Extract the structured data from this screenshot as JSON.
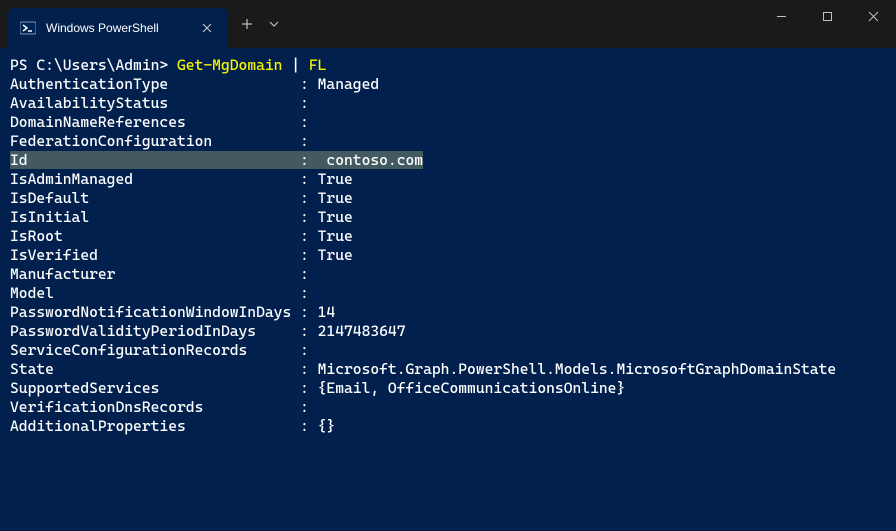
{
  "window": {
    "tab_title": "Windows PowerShell"
  },
  "prompt": {
    "path": "PS C:\\Users\\Admin> ",
    "cmd1": "Get-MgDomain",
    "pipe": " | ",
    "cmd2": "FL"
  },
  "output": {
    "props": [
      {
        "key": "AuthenticationType",
        "value": "Managed"
      },
      {
        "key": "AvailabilityStatus",
        "value": ""
      },
      {
        "key": "DomainNameReferences",
        "value": ""
      },
      {
        "key": "FederationConfiguration",
        "value": ""
      },
      {
        "key": "Id",
        "value": " contoso.com",
        "highlight": true
      },
      {
        "key": "IsAdminManaged",
        "value": "True"
      },
      {
        "key": "IsDefault",
        "value": "True"
      },
      {
        "key": "IsInitial",
        "value": "True"
      },
      {
        "key": "IsRoot",
        "value": "True"
      },
      {
        "key": "IsVerified",
        "value": "True"
      },
      {
        "key": "Manufacturer",
        "value": ""
      },
      {
        "key": "Model",
        "value": ""
      },
      {
        "key": "PasswordNotificationWindowInDays",
        "value": "14"
      },
      {
        "key": "PasswordValidityPeriodInDays",
        "value": "2147483647"
      },
      {
        "key": "ServiceConfigurationRecords",
        "value": ""
      },
      {
        "key": "State",
        "value": "Microsoft.Graph.PowerShell.Models.MicrosoftGraphDomainState"
      },
      {
        "key": "SupportedServices",
        "value": "{Email, OfficeCommunicationsOnline}"
      },
      {
        "key": "VerificationDnsRecords",
        "value": ""
      },
      {
        "key": "AdditionalProperties",
        "value": "{}"
      }
    ],
    "key_pad_width": 33
  }
}
